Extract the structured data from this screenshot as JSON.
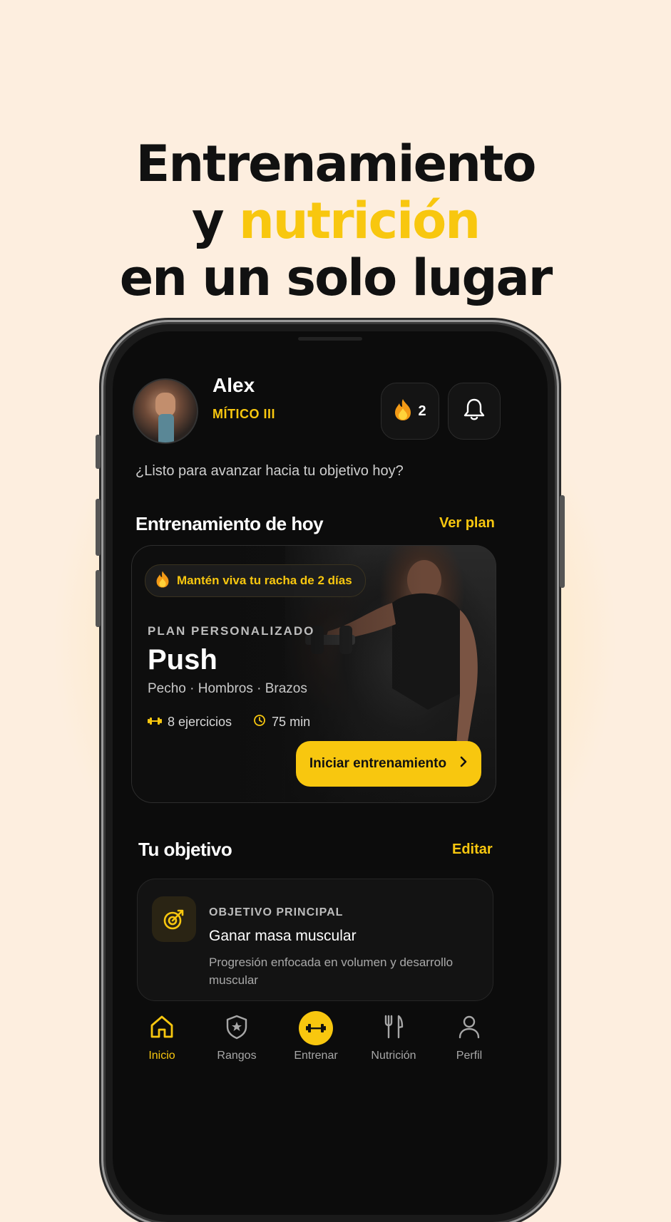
{
  "headline": {
    "line1": "Entrenamiento",
    "line2_prefix": "y ",
    "line2_accent": "nutrición",
    "line3": "en un solo lugar"
  },
  "colors": {
    "accent": "#f8c70f",
    "background": "#fdeedf",
    "screen": "#0c0c0c"
  },
  "header": {
    "user_name": "Alex",
    "rank": "MÍTICO III",
    "streak_count": "2",
    "greeting": "¿Listo para avanzar hacia tu objetivo hoy?"
  },
  "today": {
    "title": "Entrenamiento de hoy",
    "link": "Ver plan",
    "streak_message": "Mantén viva tu racha de 2 días",
    "plan_label": "PLAN PERSONALIZADO",
    "workout_name": "Push",
    "muscles": "Pecho · Hombros · Brazos",
    "exercises": "8 ejercicios",
    "duration": "75 min",
    "start_button": "Iniciar entrenamiento"
  },
  "goal": {
    "title": "Tu objetivo",
    "link": "Editar",
    "label": "OBJETIVO PRINCIPAL",
    "name": "Ganar masa muscular",
    "description": "Progresión enfocada en volumen y desarrollo muscular"
  },
  "tabs": [
    {
      "label": "Inicio",
      "icon": "home-icon"
    },
    {
      "label": "Rangos",
      "icon": "shield-star-icon"
    },
    {
      "label": "Entrenar",
      "icon": "dumbbell-icon"
    },
    {
      "label": "Nutrición",
      "icon": "fork-knife-icon"
    },
    {
      "label": "Perfil",
      "icon": "user-icon"
    }
  ]
}
